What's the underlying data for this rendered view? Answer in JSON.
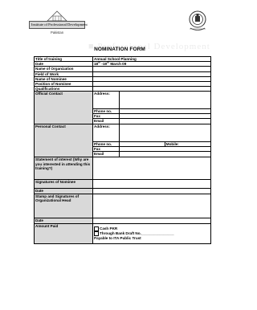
{
  "header": {
    "logo_left_text": "Institute of Professional Development",
    "logo_left_sub": "Pakistan",
    "title": "NOMINATION FORM"
  },
  "form": {
    "training_label": "Title of training",
    "training_value": "Annual School Planning",
    "date_label": "Date",
    "date_value_d1": "18",
    "date_value_s1": "th",
    "date_value_mid": " -19",
    "date_value_s2": "th",
    "date_value_end": " March 09",
    "org_label": "Name of Organization",
    "field_label": "Field of Work",
    "nominee_label": "Name of Nominee",
    "position_label": "Position of Nominee",
    "quals_label": "Qualifications",
    "official_contact_label": "Official Contact",
    "address_label": "Address:",
    "phone_label": "Phone no.",
    "fax_label": "Fax",
    "email_label": "Email",
    "personal_contact_label": "Personal Contact",
    "mobile_label": "Mobile:",
    "interest_label": "Statement of interest (Why are you interested in attending this training?)",
    "sig_nominee_label": "Signatures of Nominee",
    "date2_label": "Date",
    "stamp_label": "Stamp and Signatures of Organizational Head",
    "date3_label": "Date",
    "amount_label": "Amount Paid",
    "pay_cash": "Cash PKR",
    "pay_draft": "Through Bank Draft No.________________",
    "pay_payable": "Payable to ITA Public Trust"
  }
}
